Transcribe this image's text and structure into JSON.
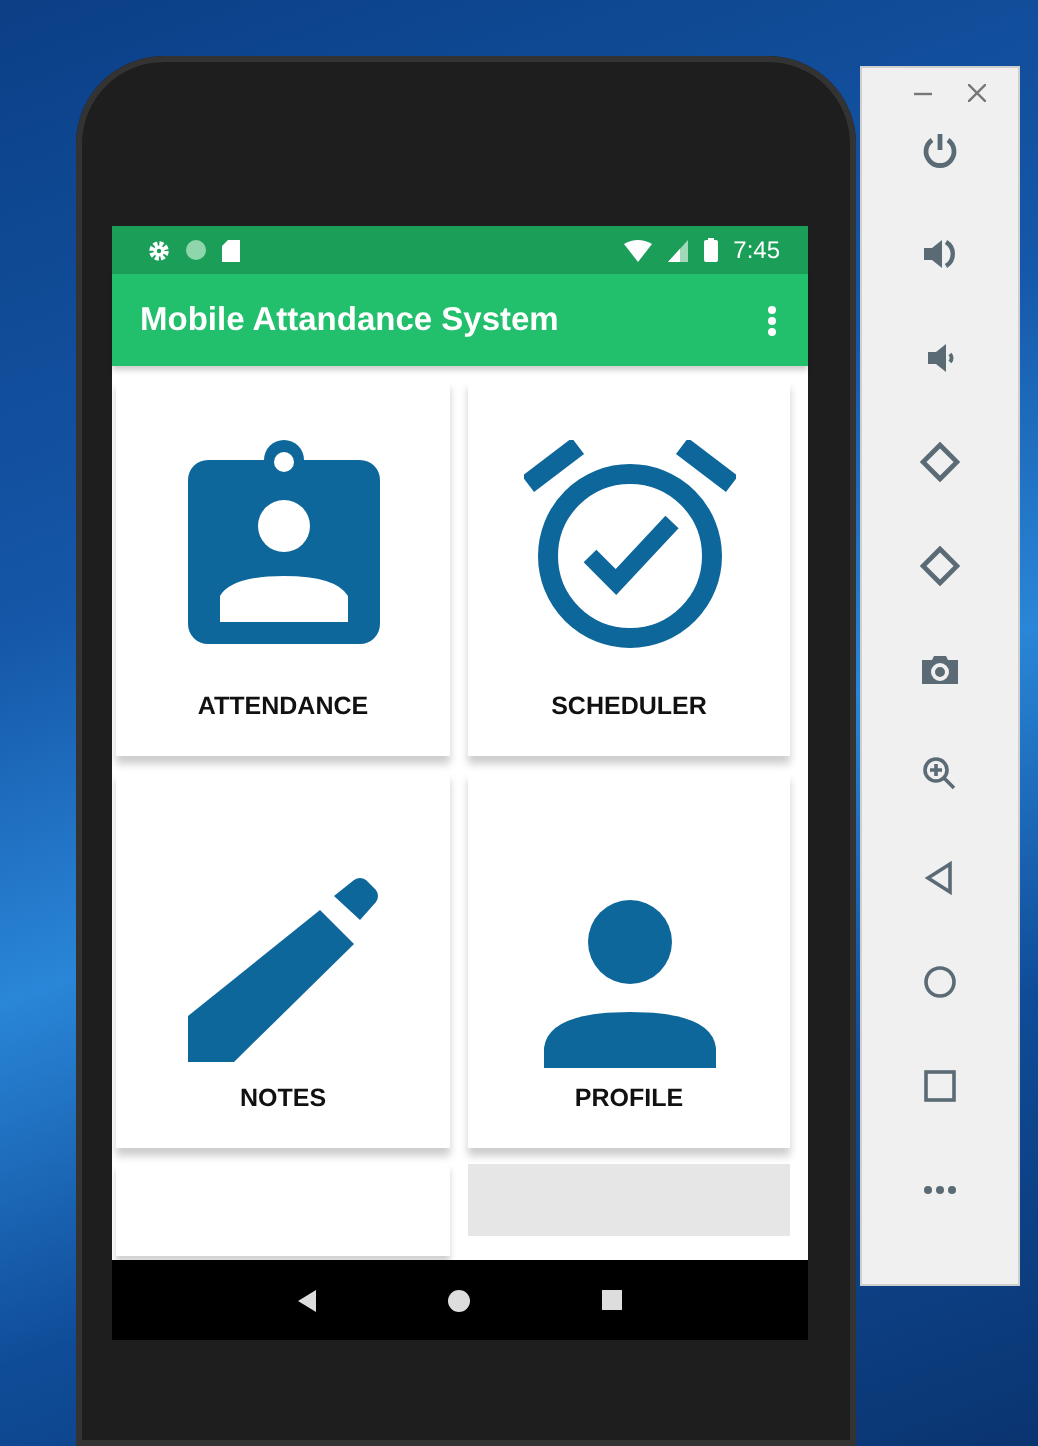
{
  "status_bar": {
    "time": "7:45"
  },
  "app_bar": {
    "title": "Mobile Attandance System"
  },
  "tiles": [
    {
      "label": "ATTENDANCE"
    },
    {
      "label": "SCHEDULER"
    },
    {
      "label": "NOTES"
    },
    {
      "label": "PROFILE"
    }
  ]
}
